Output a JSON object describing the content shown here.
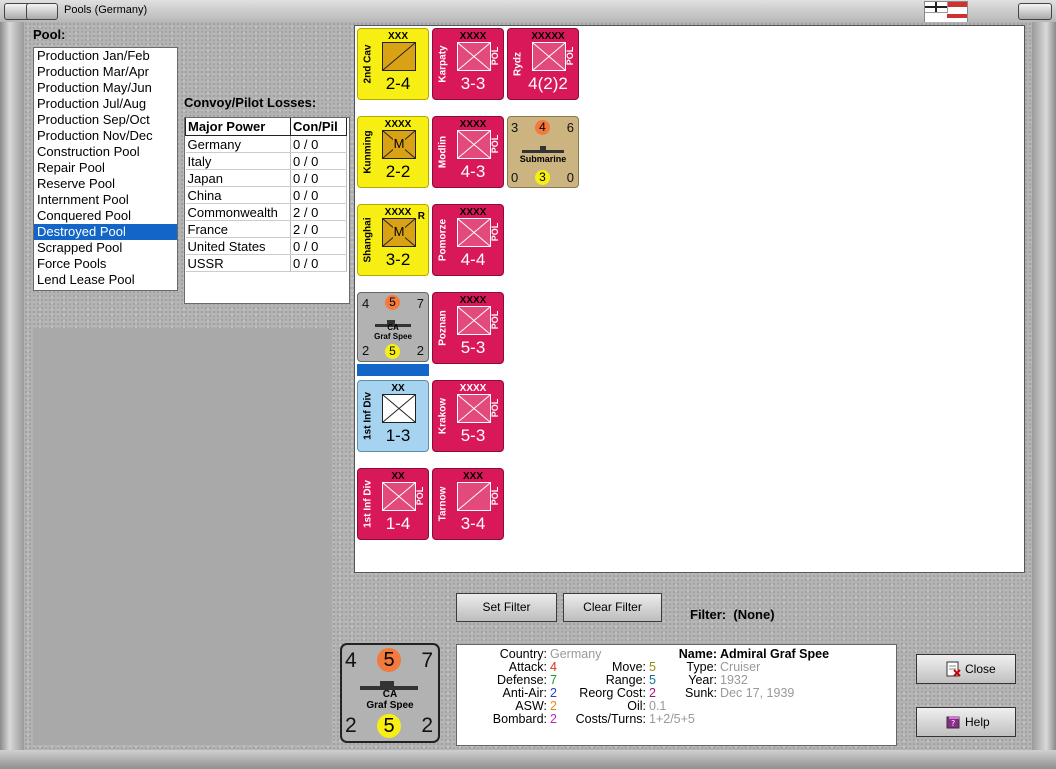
{
  "window": {
    "title": "Pools (Germany)"
  },
  "pool": {
    "label": "Pool:",
    "items": [
      "Production Jan/Feb",
      "Production Mar/Apr",
      "Production May/Jun",
      "Production Jul/Aug",
      "Production Sep/Oct",
      "Production Nov/Dec",
      "Construction Pool",
      "Repair Pool",
      "Reserve Pool",
      "Internment Pool",
      "Conquered Pool",
      "Destroyed Pool",
      "Scrapped Pool",
      "Force Pools",
      "Lend Lease Pool"
    ],
    "selected": "Destroyed Pool"
  },
  "convoy": {
    "label": "Convoy/Pilot Losses:",
    "headers": [
      "Major Power",
      "Con/Pil"
    ],
    "rows": [
      {
        "power": "Germany",
        "value": "0 / 0"
      },
      {
        "power": "Italy",
        "value": "0 / 0"
      },
      {
        "power": "Japan",
        "value": "0 / 0"
      },
      {
        "power": "China",
        "value": "0 / 0"
      },
      {
        "power": "Commonwealth",
        "value": "2 / 0"
      },
      {
        "power": "France",
        "value": "2 / 0"
      },
      {
        "power": "United States",
        "value": "0 / 0"
      },
      {
        "power": "USSR",
        "value": "0 / 0"
      }
    ]
  },
  "counters": {
    "c1": {
      "name": "2nd Cav",
      "size": "XXX",
      "strength": "2-4",
      "color": "#f7ef14"
    },
    "c2": {
      "name": "Karpaty",
      "size": "XXXX",
      "strength": "3-3",
      "nation": "POL",
      "color": "#d9185a"
    },
    "c3": {
      "name": "Rydz",
      "size": "XXXXX",
      "strength": "4(2)2",
      "nation": "POL",
      "color": "#d9185a"
    },
    "c4": {
      "name": "Kunming",
      "size": "XXXX",
      "symbol": "M",
      "strength": "2-2",
      "color": "#f7ef14"
    },
    "c5": {
      "name": "Modlin",
      "size": "XXXX",
      "strength": "4-3",
      "nation": "POL",
      "color": "#d9185a"
    },
    "c6": {
      "type": "Submarine",
      "attack": "3",
      "defense_top": "4",
      "move": "6",
      "aa": "0",
      "bottom_circle": "3",
      "range": "0",
      "color": "#cbb47f"
    },
    "c7": {
      "name": "Shanghai",
      "size": "XXXX",
      "reserve": "R",
      "symbol": "M",
      "strength": "3-2",
      "color": "#f7ef14"
    },
    "c8": {
      "name": "Pomorze",
      "size": "XXXX",
      "strength": "4-4",
      "nation": "POL",
      "color": "#d9185a"
    },
    "c9": {
      "class": "CA",
      "name": "Graf Spee",
      "tl": "4",
      "tc": "5",
      "tr": "7",
      "bl": "2",
      "bc": "5",
      "br": "2",
      "color": "#b2b2b2"
    },
    "c10": {
      "name": "Poznan",
      "size": "XXXX",
      "strength": "5-3",
      "nation": "POL",
      "color": "#d9185a"
    },
    "c11": {
      "name": "1st Inf Div",
      "size": "XX",
      "strength": "1-3",
      "color": "#a6d3ef"
    },
    "c12": {
      "name": "Krakow",
      "size": "XXXX",
      "strength": "5-3",
      "nation": "POL",
      "color": "#d9185a"
    },
    "c13": {
      "name": "1st Inf Div",
      "size": "XX",
      "strength": "1-4",
      "nation": "POL",
      "color": "#d9185a"
    },
    "c14": {
      "name": "Tarnow",
      "size": "XXX",
      "strength": "3-4",
      "nation": "POL",
      "color": "#d9185a"
    }
  },
  "filter": {
    "set_label": "Set Filter",
    "clear_label": "Clear Filter",
    "status_label": "Filter:",
    "status_value": "(None)"
  },
  "detail": {
    "country_label": "Country:",
    "country": "Germany",
    "attack_label": "Attack:",
    "attack": "4",
    "defense_label": "Defense:",
    "defense": "7",
    "antiair_label": "Anti-Air:",
    "antiair": "2",
    "asw_label": "ASW:",
    "asw": "2",
    "bombard_label": "Bombard:",
    "bombard": "2",
    "move_label": "Move:",
    "move": "5",
    "range_label": "Range:",
    "range": "5",
    "reorg_label": "Reorg Cost:",
    "reorg": "2",
    "oil_label": "Oil:",
    "oil": "0.1",
    "cost_label": "Costs/Turns:",
    "cost": "1+2/5+5",
    "name_label": "Name:",
    "name": "Admiral Graf Spee",
    "type_label": "Type:",
    "type": "Cruiser",
    "year_label": "Year:",
    "year": "1932",
    "sunk_label": "Sunk:",
    "sunk": "Dec 17, 1939"
  },
  "buttons": {
    "close": "Close",
    "help": "Help"
  },
  "colors": {
    "selection": "#1366c8",
    "attack": "#e03020",
    "defense": "#1a9a2a",
    "antiair": "#2040d0",
    "asw": "#e08a10",
    "bombard": "#c020c0",
    "move": "#9a8a10",
    "range": "#10709a",
    "reorg": "#a01080"
  }
}
